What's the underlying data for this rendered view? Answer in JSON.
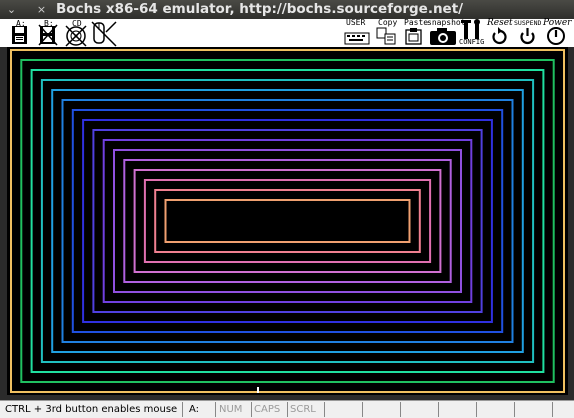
{
  "window": {
    "title": "Bochs x86-64 emulator, http://bochs.sourceforge.net/",
    "menu_glyph": "⌄",
    "close_glyph": "×"
  },
  "toolbar": {
    "floppy_a_label": "A:",
    "floppy_b_label": "B:",
    "cdrom_label": "CD",
    "user_label": "USER",
    "copy_label": "Copy",
    "paste_label": "Paste",
    "snapshot_label": "snapshot",
    "config_label": "CONFIG",
    "reset_label": "Reset",
    "suspend_label": "SUSPEND",
    "power_label": "Power"
  },
  "guest_screen": {
    "rectangle_colors": [
      "#f0c060",
      "#20c060",
      "#20e0a0",
      "#20c0c0",
      "#20a0e0",
      "#2080e0",
      "#2050e0",
      "#3030e0",
      "#5040e0",
      "#7040e0",
      "#9050e0",
      "#b060e0",
      "#d070d0",
      "#e070b0",
      "#f08090",
      "#f0a070"
    ]
  },
  "statusbar": {
    "message": "CTRL + 3rd button enables mouse",
    "drive": "A:",
    "num": "NUM",
    "caps": "CAPS",
    "scrl": "SCRL"
  }
}
